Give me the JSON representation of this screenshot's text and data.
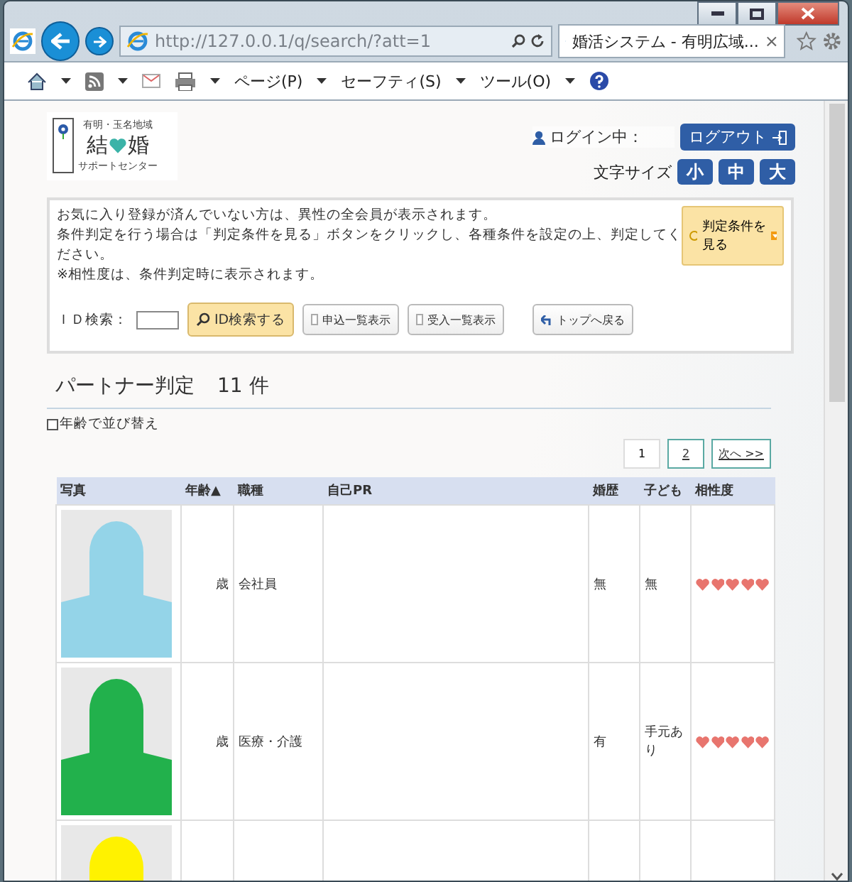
{
  "browser": {
    "address": "http://127.0.0.1/q/search/?att=1",
    "tab_title": "婚活システム - 有明広域...",
    "tab_close": "×",
    "menu": [
      "ページ(P)",
      "セーフティ(S)",
      "ツール(O)"
    ]
  },
  "header": {
    "logo": {
      "region": "有明・玉名地域",
      "name_left": "結",
      "name_right": "婚",
      "subtitle": "サポートセンター"
    },
    "login_label": "ログイン中：",
    "logout": "ログアウト",
    "font_size_label": "文字サイズ",
    "font_sizes": [
      "小",
      "中",
      "大"
    ]
  },
  "notice": {
    "lines": [
      "お気に入り登録が済んでいない方は、異性の全会員が表示されます。",
      "条件判定を行う場合は「判定条件を見る」ボタンをクリックし、各種条件を設定の上、判定してください。",
      "※相性度は、条件判定時に表示されます。"
    ],
    "criteria_button": "判定条件を見る",
    "id_search_label": "ＩＤ検索：",
    "id_search_button": "ID検索する",
    "list_buttons": [
      "申込一覧表示",
      "受入一覧表示"
    ],
    "back_button": "トップへ戻る"
  },
  "results": {
    "title": "パートナー判定",
    "count": "11 件",
    "sort": {
      "label": "年齢で並び替え",
      "checked": false
    },
    "pages": [
      {
        "label": "1",
        "selected": true
      },
      {
        "label": "2",
        "selected": false
      }
    ],
    "next": "次へ >>",
    "columns": [
      "写真",
      "年齢▲",
      "職種",
      "自己PR",
      "婚歴",
      "子ども",
      "相性度"
    ],
    "rows": [
      {
        "color": "#94d4e8",
        "age": "歳",
        "job": "会社員",
        "marriage": "無",
        "children": "無",
        "stars": 5
      },
      {
        "color": "#22b14c",
        "age": "歳",
        "job": "医療・介護",
        "marriage": "有",
        "children": "手元あり",
        "stars": 5
      },
      {
        "color": "#fff200"
      }
    ]
  }
}
